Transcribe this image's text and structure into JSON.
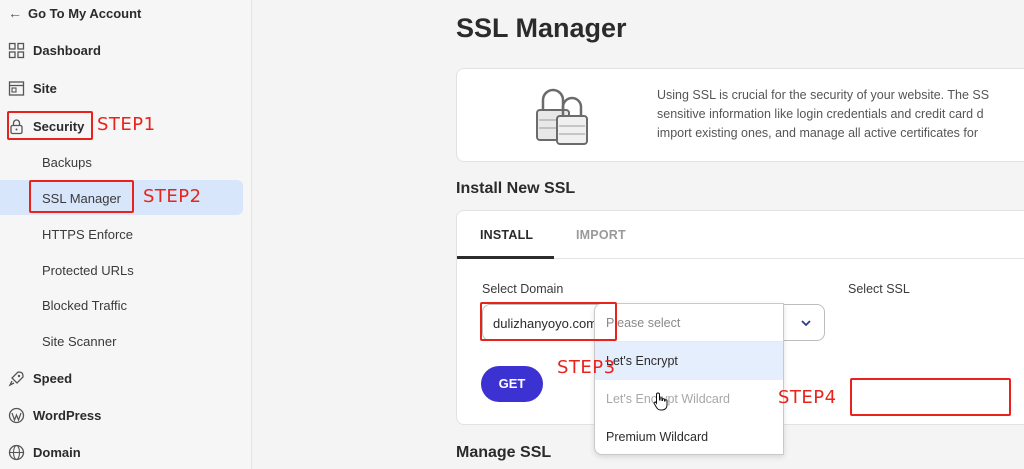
{
  "sidebar": {
    "back_label": "Go To My Account",
    "items": [
      {
        "label": "Dashboard",
        "icon": "dashboard-icon"
      },
      {
        "label": "Site",
        "icon": "site-icon"
      },
      {
        "label": "Security",
        "icon": "lock-icon"
      },
      {
        "label": "Speed",
        "icon": "rocket-icon"
      },
      {
        "label": "WordPress",
        "icon": "wordpress-icon"
      },
      {
        "label": "Domain",
        "icon": "globe-icon"
      }
    ],
    "security_sub": [
      "Backups",
      "SSL Manager",
      "HTTPS Enforce",
      "Protected URLs",
      "Blocked Traffic",
      "Site Scanner"
    ],
    "active_sub": "SSL Manager"
  },
  "annotations": {
    "step1": "STEP1",
    "step2": "STEP2",
    "step3": "STEP3",
    "step4": "STEP4",
    "color": "#e8231b"
  },
  "main": {
    "title": "SSL Manager",
    "info_lines": [
      "Using SSL is crucial for the security of your website. The SS",
      "sensitive information like login credentials and credit card d",
      "import existing ones, and manage all active certificates for"
    ],
    "install_title": "Install New SSL",
    "tabs": [
      "INSTALL",
      "IMPORT"
    ],
    "active_tab": "INSTALL",
    "select_domain_label": "Select Domain",
    "domain_value": "dulizhanyoyo.com",
    "select_ssl_label": "Select SSL",
    "ssl_placeholder": "Please select",
    "ssl_options": [
      "Let's Encrypt",
      "Let's Encrypt Wildcard",
      "Premium Wildcard"
    ],
    "get_button": "GET",
    "manage_title": "Manage SSL"
  },
  "colors": {
    "accent": "#3c32d2",
    "active_bg": "#d7e6fb"
  }
}
